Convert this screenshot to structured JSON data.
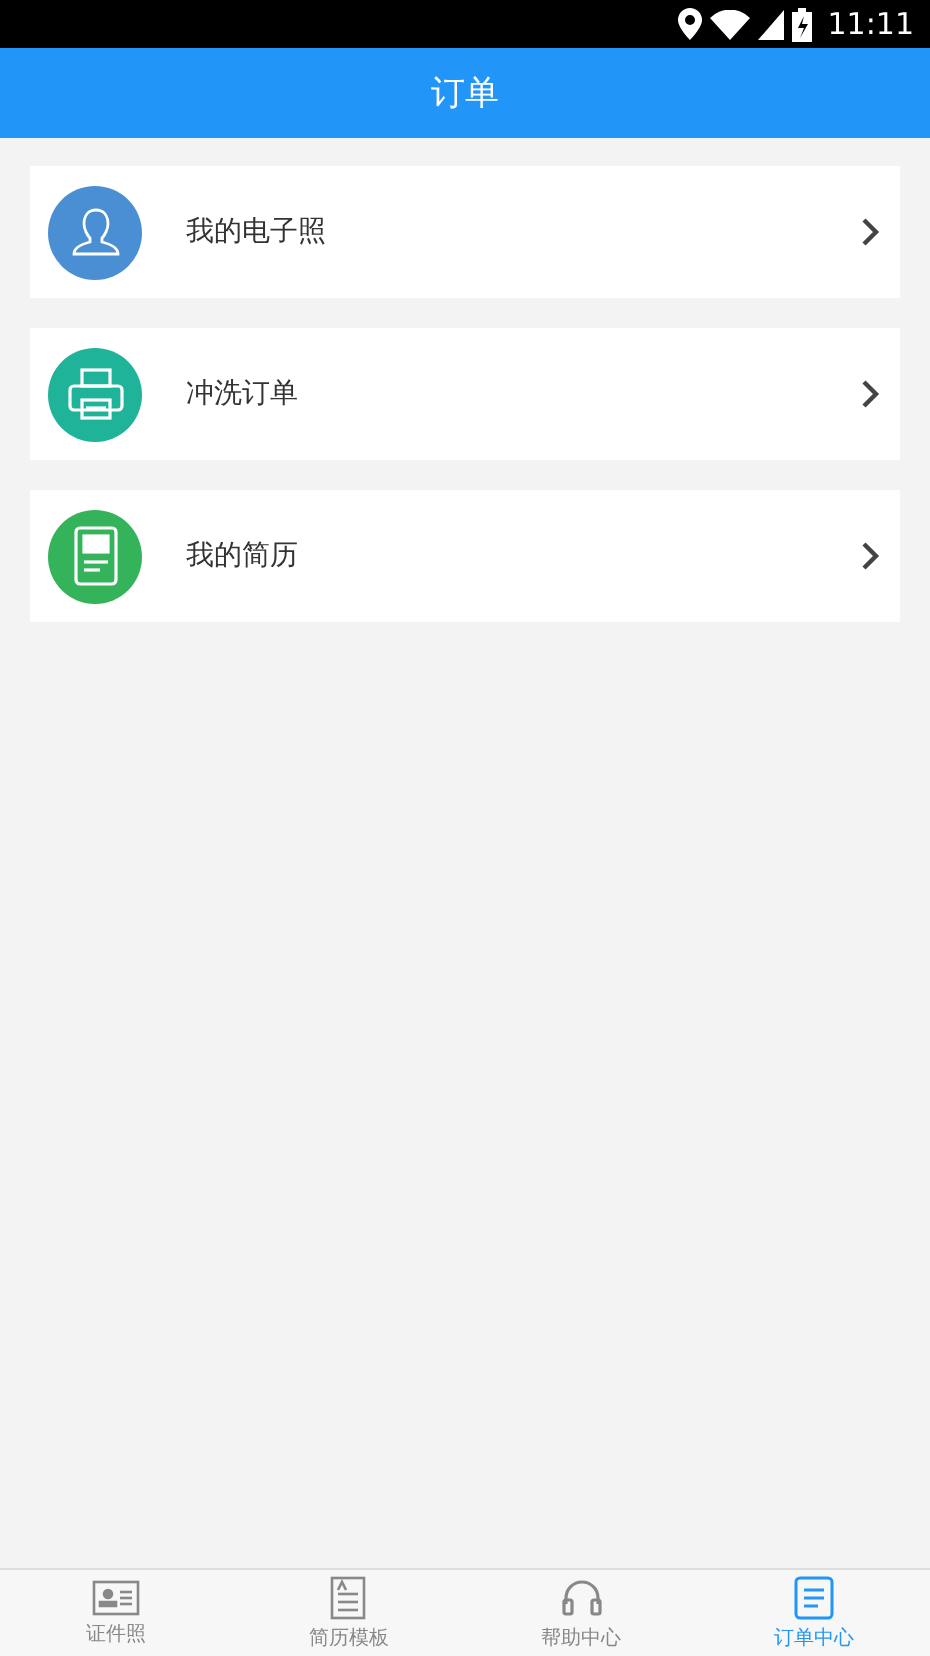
{
  "status_bar": {
    "time": "11:11"
  },
  "header": {
    "title": "订单"
  },
  "menu_items": [
    {
      "label": "我的电子照",
      "kind": "person",
      "color": "#4a8fd4"
    },
    {
      "label": "冲洗订单",
      "kind": "printer",
      "color": "#1fb39a"
    },
    {
      "label": "我的简历",
      "kind": "resume",
      "color": "#34b35a"
    }
  ],
  "tab_bar": [
    {
      "label": "证件照",
      "kind": "idcard",
      "selected": false
    },
    {
      "label": "简历模板",
      "kind": "template",
      "selected": false
    },
    {
      "label": "帮助中心",
      "kind": "headset",
      "selected": false
    },
    {
      "label": "订单中心",
      "kind": "orders",
      "selected": true
    }
  ]
}
